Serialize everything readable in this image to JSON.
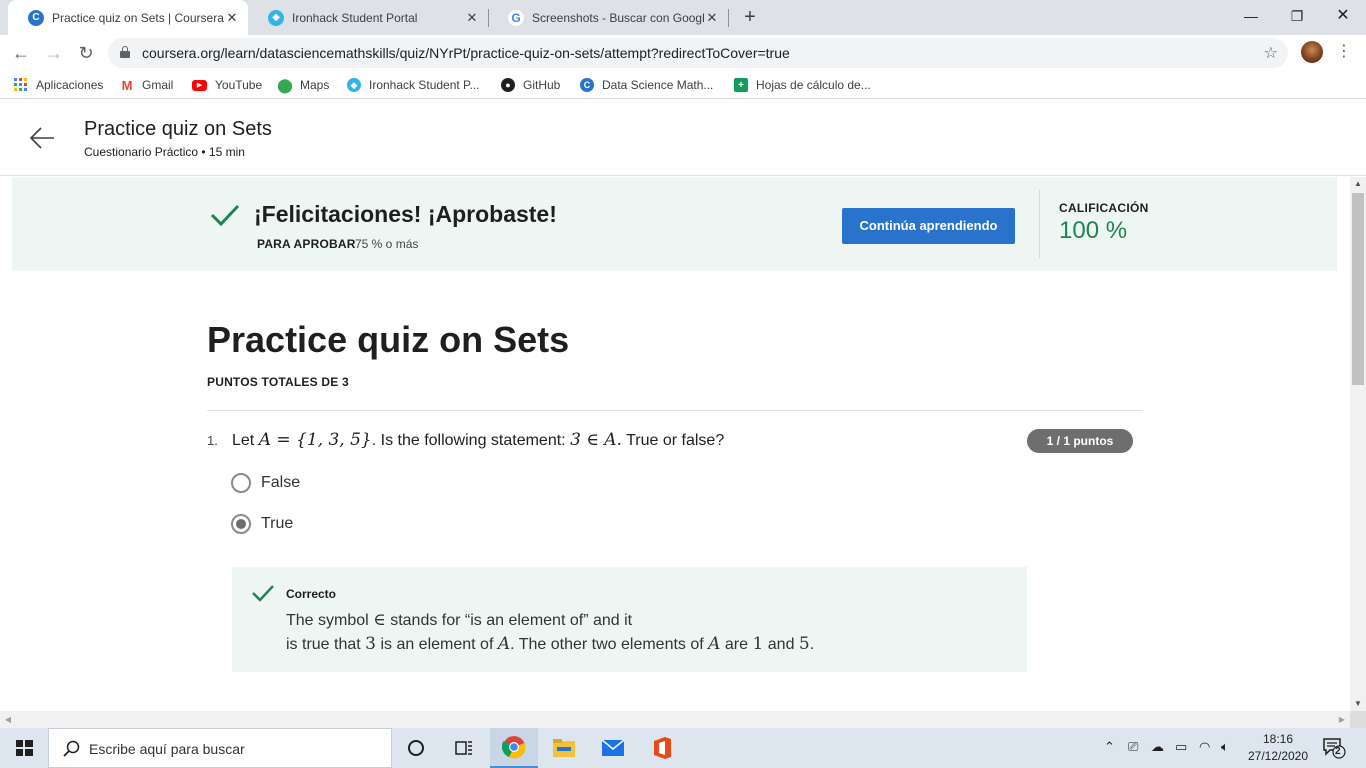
{
  "browser": {
    "tabs": [
      {
        "title": "Practice quiz on Sets | Coursera",
        "favicon": "coursera-icon",
        "active": true
      },
      {
        "title": "Ironhack Student Portal",
        "favicon": "ironhack-icon",
        "active": false
      },
      {
        "title": "Screenshots - Buscar con Google",
        "favicon": "google-icon",
        "active": false
      }
    ],
    "tab_close": "✕",
    "new_tab": "+",
    "url": "coursera.org/learn/datasciencemathskills/quiz/NYrPt/practice-quiz-on-sets/attempt?redirectToCover=true",
    "bookmarks": [
      {
        "label": "Aplicaciones",
        "icon": "apps-grid-icon"
      },
      {
        "label": "Gmail",
        "icon": "gmail-icon"
      },
      {
        "label": "YouTube",
        "icon": "youtube-icon"
      },
      {
        "label": "Maps",
        "icon": "maps-icon"
      },
      {
        "label": "Ironhack Student P...",
        "icon": "ironhack-icon"
      },
      {
        "label": "GitHub",
        "icon": "github-icon"
      },
      {
        "label": "Data Science Math...",
        "icon": "coursera-icon"
      },
      {
        "label": "Hojas de cálculo de...",
        "icon": "sheets-icon"
      }
    ]
  },
  "header": {
    "title": "Practice quiz on Sets",
    "subtitle": "Cuestionario Práctico • 15 min"
  },
  "banner": {
    "message": "¡Felicitaciones! ¡Aprobaste!",
    "pass_label": "PARA APROBAR",
    "pass_value": "75 % o más",
    "continue_label": "Continúa aprendiendo",
    "grade_label": "CALIFICACIÓN",
    "grade_value": "100 %"
  },
  "quiz": {
    "title": "Practice quiz on Sets",
    "total_points": "PUNTOS TOTALES DE 3",
    "question": {
      "number": "1.",
      "prefix": "Let",
      "set_expr": "A = {1, 3, 5}",
      "middle": ". Is the following statement:",
      "statement": "3 ∈ A.",
      "suffix": "True or false?",
      "points": "1 / 1 puntos",
      "options": [
        {
          "label": "False",
          "selected": false
        },
        {
          "label": "True",
          "selected": true
        }
      ],
      "feedback": {
        "label": "Correcto",
        "line1_a": "The symbol",
        "line1_sym": "∈",
        "line1_b": "stands for “is an element of” and it",
        "line2_a": "is true that",
        "line2_3": "3",
        "line2_b": "is an element of",
        "line2_A": "A",
        "line2_c": ". The other two elements of",
        "line2_A2": "A",
        "line2_d": "are",
        "line2_1": "1",
        "line2_e": "and",
        "line2_5": "5",
        "line2_f": "."
      }
    }
  },
  "taskbar": {
    "search_placeholder": "Escribe aquí para buscar",
    "time": "18:16",
    "date": "27/12/2020",
    "notification_count": "2"
  },
  "colors": {
    "accent_blue": "#2a73cc",
    "success_green": "#1f8354",
    "banner_bg": "#eef6f3"
  }
}
